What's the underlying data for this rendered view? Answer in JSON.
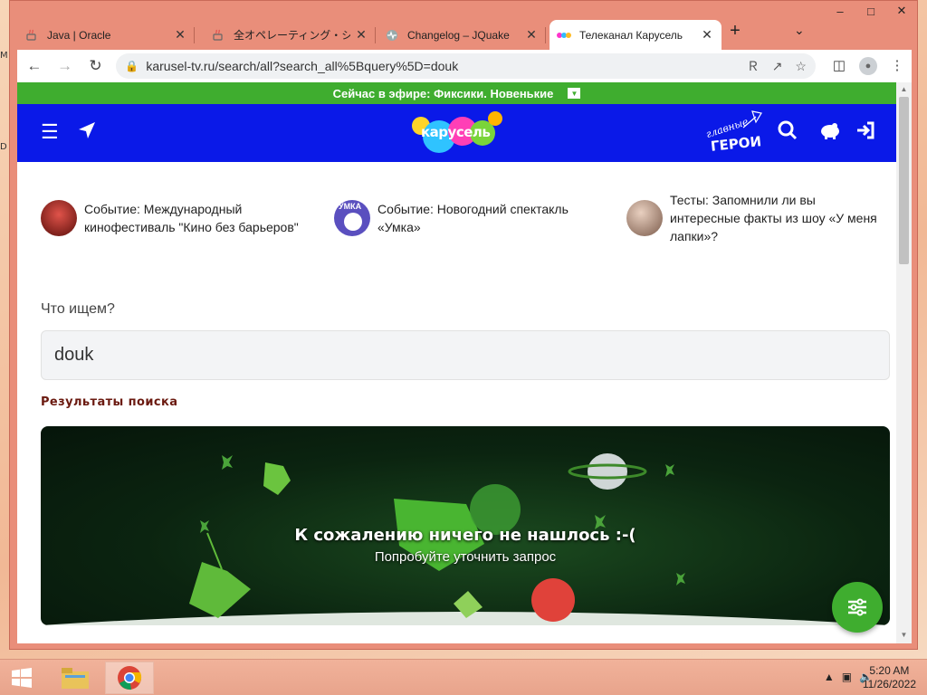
{
  "browser": {
    "tabs": [
      {
        "title": "Java | Oracle",
        "icon": "java-icon",
        "active": false
      },
      {
        "title": "全オペレーティング・システ",
        "icon": "java-icon",
        "active": false
      },
      {
        "title": "Changelog – JQuake",
        "icon": "jquake-icon",
        "active": false
      },
      {
        "title": "Телеканал Карусель",
        "icon": "karusel-icon",
        "active": true
      }
    ],
    "new_tab": "+",
    "url": "karusel-tv.ru/search/all?search_all%5Bquery%5D=douk"
  },
  "page": {
    "on_air": "Сейчас в эфире: Фиксики. Новенькие",
    "logo_text": "карусель",
    "heroes": {
      "small": "главные",
      "big": "ГЕРОИ"
    },
    "events": [
      {
        "text": "Событие: Международный кинофестиваль \"Кино без барьеров\"",
        "pic": "festival-thumbnail"
      },
      {
        "text": "Событие: Новогодний спектакль «Умка»",
        "pic": "umka-thumbnail",
        "badge": "УМКА"
      },
      {
        "text": "Тесты: Запомнили ли вы интересные факты из шоу «У меня лапки»?",
        "pic": "quiz-thumbnail"
      }
    ],
    "search": {
      "label": "Что ищем?",
      "value": "douk"
    },
    "results_title": "Результаты поиска",
    "empty": {
      "title": "К сожалению ничего не нашлось :-(",
      "hint": "Попробуйте уточнить запрос"
    }
  },
  "colors": {
    "brand_blue": "#0a19e8",
    "brand_green": "#3fad2f",
    "heading_brown": "#6b1a10"
  },
  "taskbar": {
    "time": "5:20 AM",
    "date": "11/26/2022"
  },
  "desktop_strip": [
    "M",
    "D"
  ]
}
